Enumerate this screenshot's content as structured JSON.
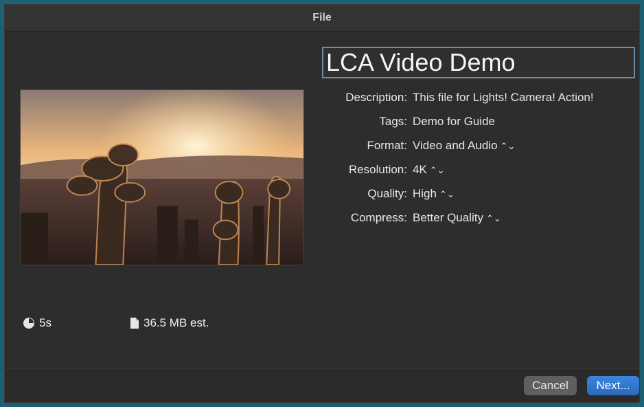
{
  "window": {
    "title": "File"
  },
  "name_field": {
    "value": "LCA Video Demo"
  },
  "properties": [
    {
      "label": "Description:",
      "value": "This file for Lights! Camera! Action!",
      "has_chevron": false
    },
    {
      "label": "Tags:",
      "value": "Demo for Guide",
      "has_chevron": false
    },
    {
      "label": "Format:",
      "value": "Video and Audio",
      "has_chevron": true
    },
    {
      "label": "Resolution:",
      "value": "4K",
      "has_chevron": true
    },
    {
      "label": "Quality:",
      "value": "High",
      "has_chevron": true
    },
    {
      "label": "Compress:",
      "value": "Better Quality",
      "has_chevron": true
    }
  ],
  "stats": {
    "duration": "5s",
    "size": "36.5 MB est."
  },
  "buttons": {
    "cancel": "Cancel",
    "next": "Next..."
  },
  "icons": {
    "chevron": "updown-chevron-icon",
    "duration": "clock-icon",
    "size": "document-icon"
  }
}
